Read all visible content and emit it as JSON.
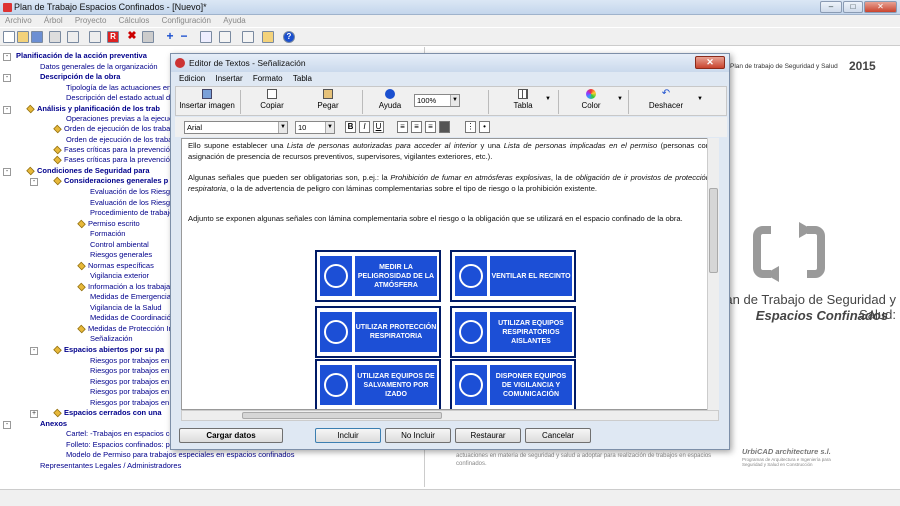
{
  "window": {
    "title": "Plan de Trabajo Espacios Confinados - [Nuevo]*",
    "controls": {
      "minimize": "–",
      "maximize": "□",
      "close": "✕"
    }
  },
  "menu": [
    "Archivo",
    "Árbol",
    "Proyecto",
    "Cálculos",
    "Configuración",
    "Ayuda"
  ],
  "tree": [
    {
      "label": "Planificación de la acción preventiva",
      "bold": true
    },
    {
      "label": "Datos generales de la organización"
    },
    {
      "label": "Descripción de la obra",
      "bold": true
    },
    {
      "label": "Tipología de las actuaciones en e"
    },
    {
      "label": "Descripción del estado actual del"
    },
    {
      "label": "Análisis y planificación de los trab",
      "bold": true
    },
    {
      "label": "Operaciones previas a la ejecució"
    },
    {
      "label": "Orden de ejecución de los trabajo"
    },
    {
      "label": "Orden de ejecución de los trabajo"
    },
    {
      "label": "Fases críticas para la prevención,"
    },
    {
      "label": "Fases críticas para la prevención,"
    },
    {
      "label": "Condiciones de Seguridad para",
      "bold": true
    },
    {
      "label": "Consideraciones generales p",
      "bold": true
    },
    {
      "label": "Evaluación de los Riesgo"
    },
    {
      "label": "Evaluación de los Riesgo"
    },
    {
      "label": "Procedimiento de trabajo"
    },
    {
      "label": "Permiso escrito"
    },
    {
      "label": "Formación"
    },
    {
      "label": "Control ambiental"
    },
    {
      "label": "Riesgos generales"
    },
    {
      "label": "Normas específicas"
    },
    {
      "label": "Vigilancia exterior"
    },
    {
      "label": "Información a los trabaja"
    },
    {
      "label": "Medidas de Emergencia"
    },
    {
      "label": "Vigilancia de la Salud"
    },
    {
      "label": "Medidas de Coordinación"
    },
    {
      "label": "Medidas de Protección In"
    },
    {
      "label": "Señalización"
    },
    {
      "label": "Espacios abiertos por su pa",
      "bold": true
    },
    {
      "label": "Riesgos por trabajos en F"
    },
    {
      "label": "Riesgos por trabajos en P"
    },
    {
      "label": "Riesgos por trabajos en D"
    },
    {
      "label": "Riesgos por trabajos en C"
    },
    {
      "label": "Riesgos por trabajos en S"
    },
    {
      "label": "Espacios cerrados con una",
      "bold": true
    },
    {
      "label": "Anexos",
      "bold": true
    },
    {
      "label": "Cartel: -Trabajos en espacios con"
    },
    {
      "label": "Folleto: Espacios confinados: pel"
    },
    {
      "label": "Modelo de Permiso para trabajos especiales en espacios confinados"
    },
    {
      "label": "Representantes Legales / Administradores"
    }
  ],
  "right": {
    "header_small": "Plan de trabajo de Seguridad y Salud",
    "year": "2015",
    "center_title_1": "Plan de Trabajo de Seguridad y Salud:",
    "center_title_2": "Espacios Confinados",
    "brand": "UrbiCAD architecture s.l.",
    "brand_sub": "Programas de Arquitectura e Ingeniería para Seguridad y Salud en Construcción",
    "bottom_text": "actuaciones en materia de seguridad y salud a adoptar para realización de trabajos en espacios confinados."
  },
  "dialog": {
    "title": "Editor de Textos - Señalización",
    "close": "✕",
    "menu": [
      "Edicion",
      "Insertar",
      "Formato",
      "Tabla"
    ],
    "toolbar": {
      "insert_image": "Insertar imagen",
      "copy": "Copiar",
      "paste": "Pegar",
      "help": "Ayuda",
      "zoom": "100%",
      "table": "Tabla",
      "color": "Color",
      "undo": "Deshacer"
    },
    "font": "Arial",
    "size": "10",
    "format_buttons": [
      "B",
      "I",
      "U"
    ],
    "para1_a": "Ello supone establecer una ",
    "para1_b": "Lista de personas autorizadas para acceder al interior",
    "para1_c": " y una ",
    "para1_d": "Lista de personas implicadas en el permiso",
    "para1_e": " (personas con asignación de presencia de recursos preventivos, supervisores, vigilantes exteriores, etc.).",
    "para2_a": "Algunas señales que pueden ser obligatorias son, p.ej.: la ",
    "para2_b": "Prohibición de fumar en atmósferas explosivas",
    "para2_c": ", la de ",
    "para2_d": "obligación de ir provistos de protección respiratoria",
    "para2_e": ", o la de advertencia de peligro con láminas complementarias sobre el tipo de riesgo o la prohibición existente.",
    "para3": "Adjunto se exponen algunas señales con lámina complementaria sobre el riesgo o la obligación que se utilizará en el espacio confinado de la obra.",
    "signs": [
      "MEDIR LA PELIGROSIDAD DE LA ATMÓSFERA",
      "VENTILAR EL RECINTO",
      "UTILIZAR PROTECCIÓN RESPIRATORIA",
      "UTILIZAR EQUIPOS RESPIRATORIOS AISLANTES",
      "UTILIZAR EQUIPOS DE SALVAMENTO POR IZADO",
      "DISPONER EQUIPOS DE VIGILANCIA Y COMUNICACIÓN"
    ],
    "buttons": {
      "load": "Cargar datos",
      "include": "Incluir",
      "not_include": "No Incluir",
      "restore": "Restaurar",
      "cancel": "Cancelar"
    }
  },
  "colors": {
    "sign_blue": "#1c4fd6",
    "tree_text": "#00008b"
  }
}
